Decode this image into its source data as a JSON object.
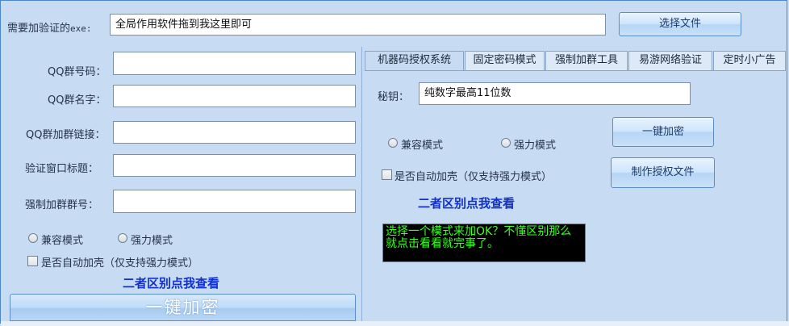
{
  "top": {
    "exe_label": "需要加验证的",
    "exe_label_suffix": "exe:",
    "exe_input_value": "全局作用软件拖到我这里即可",
    "select_file_button": "选择文件"
  },
  "left": {
    "qq_group_number_label": "QQ群号码：",
    "qq_group_name_label": "QQ群名字：",
    "qq_join_link_label": "QQ群加群链接：",
    "verify_window_title_label": "验证窗口标题：",
    "force_join_group_label": "强制加群群号：",
    "qq_group_number_value": "",
    "qq_group_name_value": "",
    "qq_join_link_value": "",
    "verify_window_title_value": "",
    "force_join_group_value": "",
    "radio_compatible": "兼容模式",
    "radio_strong": "强力模式",
    "auto_pack_checkbox": "是否自动加壳（仅支持强力模式）",
    "difference_link": "二者区别点我查看",
    "encrypt_button": "一键加密"
  },
  "tabs": [
    {
      "label": "机器码授权系统",
      "active": true
    },
    {
      "label": "固定密码模式",
      "active": false
    },
    {
      "label": "强制加群工具",
      "active": false
    },
    {
      "label": "易游网络验证",
      "active": false
    },
    {
      "label": "定时小广告",
      "active": false
    }
  ],
  "right": {
    "secret_key_label": "秘钥：",
    "secret_key_value": "纯数字最高11位数",
    "encrypt_button": "一键加密",
    "radio_compatible": "兼容模式",
    "radio_strong": "强力模式",
    "make_license_button": "制作授权文件",
    "auto_pack_checkbox": "是否自动加壳（仅支持强力模式）",
    "difference_link": "二者区别点我查看",
    "console_text": "选择一个模式来加OK？不懂区别那么就点击看看就完事了。"
  },
  "colors": {
    "window_bg": "#c7dcf3",
    "link_blue": "#1030d0",
    "console_green": "#3cff22",
    "console_bg": "#000000"
  }
}
